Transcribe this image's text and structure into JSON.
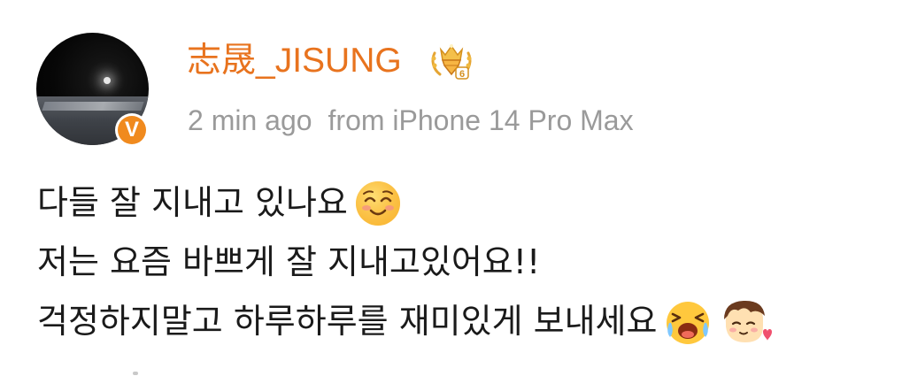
{
  "post": {
    "author": {
      "name": "志晟_JISUNG",
      "verified_badge": "V",
      "avatar": "avatar-dark-stage",
      "level_badge_icon": "crown-level-icon"
    },
    "meta": {
      "time": "2 min ago",
      "source": "from iPhone 14 Pro Max"
    },
    "lines": [
      {
        "text": "다들 잘 지내고 있나요",
        "emoji": "smiling-blush-emoji"
      },
      {
        "text": "저는 요즘 바쁘게 잘 지내고있어요!!"
      },
      {
        "text": "걱정하지말고 하루하루를 재미있게 보내세요",
        "emojis": [
          "laughing-crying-emoji",
          "boy-with-heart-emoji"
        ]
      }
    ]
  },
  "colors": {
    "username": "#e8731e",
    "meta": "#9a9a9a",
    "verified": "#f08a1e",
    "text": "#1a1a1a"
  }
}
